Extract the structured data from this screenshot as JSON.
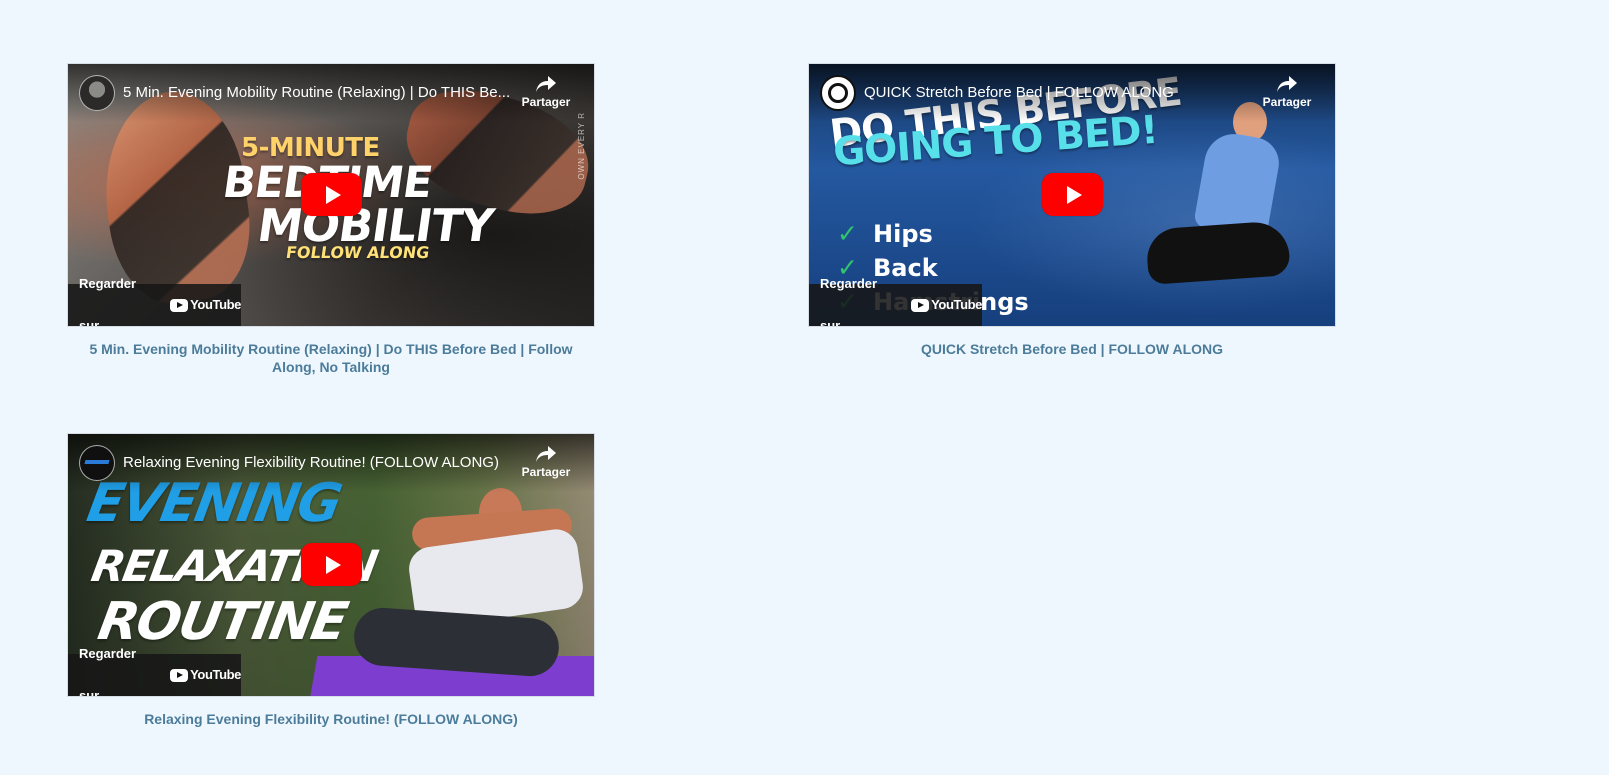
{
  "videos": [
    {
      "title": "5 Min. Evening Mobility Routine (Relaxing) | Do THIS Before Bed | Follow Along, No Talking",
      "player_title": "5 Min. Evening Mobility Routine (Relaxing) | Do THIS Be...",
      "share_label": "Partager",
      "watch_on_label": "Regarder sur",
      "youtube_label": "YouTube",
      "thumbnail_text": {
        "line_1": "5-MINUTE",
        "line_2": "BEDTIME",
        "line_3": "MOBILITY",
        "line_4": "FOLLOW ALONG",
        "side_text": "OWN EVERY R"
      }
    },
    {
      "title": "QUICK Stretch Before Bed | FOLLOW ALONG",
      "player_title": "QUICK Stretch Before Bed | FOLLOW ALONG",
      "share_label": "Partager",
      "watch_on_label": "Regarder sur",
      "youtube_label": "YouTube",
      "thumbnail_text": {
        "line_1": "DO THIS BEFORE",
        "line_2_prefix": "GOING TO",
        "line_2_highlight": "BED!",
        "checks": [
          "Hips",
          "Back",
          "Hamstrings"
        ]
      }
    },
    {
      "title": "Relaxing Evening Flexibility Routine! (FOLLOW ALONG)",
      "player_title": "Relaxing Evening Flexibility Routine! (FOLLOW ALONG)",
      "share_label": "Partager",
      "watch_on_label": "Regarder sur",
      "youtube_label": "YouTube",
      "thumbnail_text": {
        "line_1": "EVENING",
        "line_2": "RELAXATION",
        "line_3": "ROUTINE"
      }
    }
  ],
  "colors": {
    "page_background": "#eef7fe",
    "caption_text": "#4c7c99",
    "youtube_red": "#ff0000"
  },
  "icons": {
    "share": "share-arrow-icon",
    "play": "play-icon",
    "youtube": "youtube-logo-icon"
  }
}
